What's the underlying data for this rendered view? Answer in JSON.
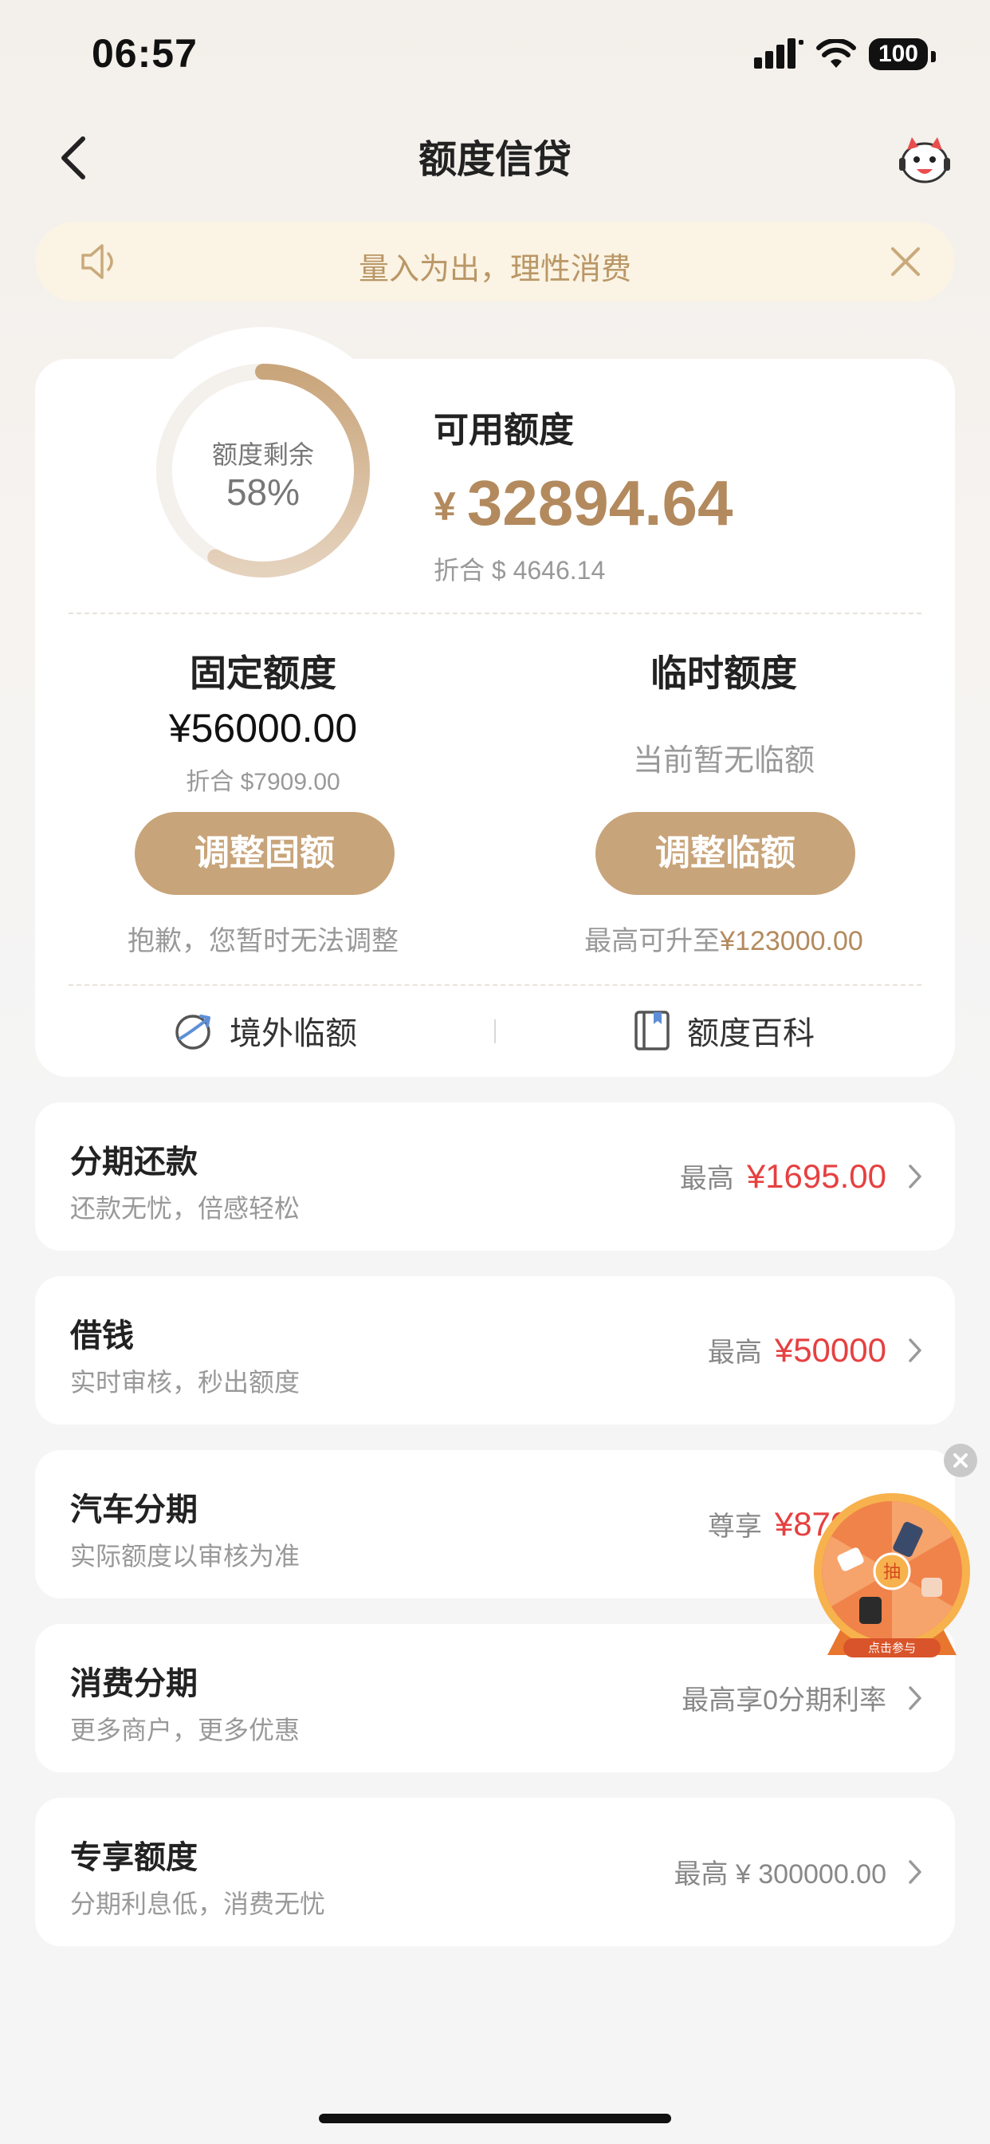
{
  "status_bar": {
    "time": "06:57",
    "battery": "100"
  },
  "nav": {
    "title": "额度信贷"
  },
  "notice": {
    "text": "量入为出，理性消费"
  },
  "overview": {
    "ring_label": "额度剩余",
    "ring_percent": "58%",
    "ring_fraction": 0.58,
    "available_title": "可用额度",
    "currency": "¥",
    "available_amount": "32894.64",
    "available_converted": "折合 $ 4646.14"
  },
  "fixed_quota": {
    "title": "固定额度",
    "amount": "¥56000.00",
    "converted": "折合 $7909.00",
    "button": "调整固额",
    "note": "抱歉，您暂时无法调整"
  },
  "temp_quota": {
    "title": "临时额度",
    "status": "当前暂无临额",
    "button": "调整临额",
    "note_prefix": "最高可升至",
    "note_amount": "¥123000.00"
  },
  "links": {
    "overseas": "境外临额",
    "wiki": "额度百科"
  },
  "list": [
    {
      "title": "分期还款",
      "sub": "还款无忧，倍感轻松",
      "prefix": "最高",
      "amount": "¥1695.00"
    },
    {
      "title": "借钱",
      "sub": "实时审核，秒出额度",
      "prefix": "最高",
      "amount": "¥50000"
    },
    {
      "title": "汽车分期",
      "sub": "实际额度以审核为准",
      "prefix": "尊享",
      "amount": "¥87000"
    },
    {
      "title": "消费分期",
      "sub": "更多商户，更多优惠",
      "prefix": "最高享0分期利率",
      "amount": ""
    },
    {
      "title": "专享额度",
      "sub": "分期利息低，消费无忧",
      "prefix": "最高 ¥ 300000.00",
      "amount": ""
    }
  ],
  "floating": {
    "wheel_center": "抽",
    "wheel_caption": "点击参与"
  },
  "colors": {
    "accent": "#c8a47a",
    "accent_text": "#b38a5e",
    "red": "#e64040",
    "notice_bg": "#fbf3e3"
  }
}
